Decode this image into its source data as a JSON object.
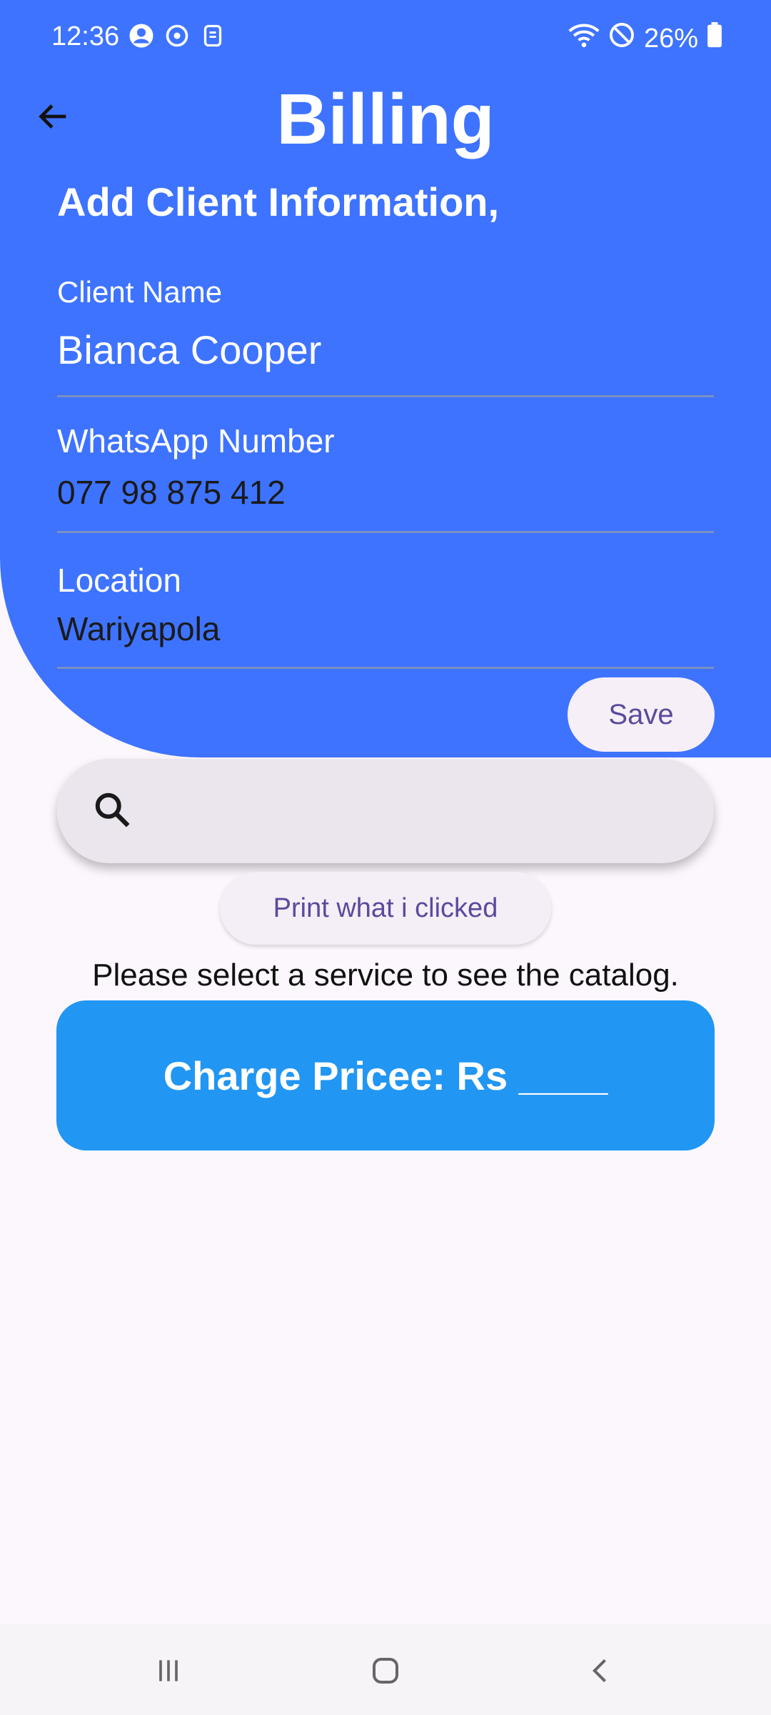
{
  "status_bar": {
    "time": "12:36",
    "battery_percent": "26%",
    "icons_left": [
      "account-circle-icon",
      "sync-icon",
      "sim-icon"
    ],
    "icons_right": [
      "wifi-icon",
      "do-not-disturb-icon",
      "battery-icon"
    ]
  },
  "header": {
    "title": "Billing",
    "section_title": "Add Client Information,",
    "back_icon": "arrow-back-icon"
  },
  "form": {
    "client_name": {
      "label": "Client Name",
      "value": "Bianca Cooper"
    },
    "whatsapp": {
      "label": "WhatsApp Number",
      "value": "077 98 875 412"
    },
    "location": {
      "label": "Location",
      "value": "Wariyapola"
    },
    "save_label": "Save"
  },
  "search": {
    "icon": "search-icon",
    "value": ""
  },
  "actions": {
    "print_label": "Print what i clicked",
    "catalog_message": "Please select a service to see the catalog.",
    "charge_label": "Charge Pricee: Rs ____"
  },
  "nav_bar": {
    "items": [
      "recent-apps-icon",
      "home-icon",
      "back-icon"
    ]
  },
  "colors": {
    "header_blue": "#3e73ff",
    "charge_blue": "#2196f3",
    "button_text_purple": "#5b4a9c",
    "background": "#fcf7fd"
  }
}
